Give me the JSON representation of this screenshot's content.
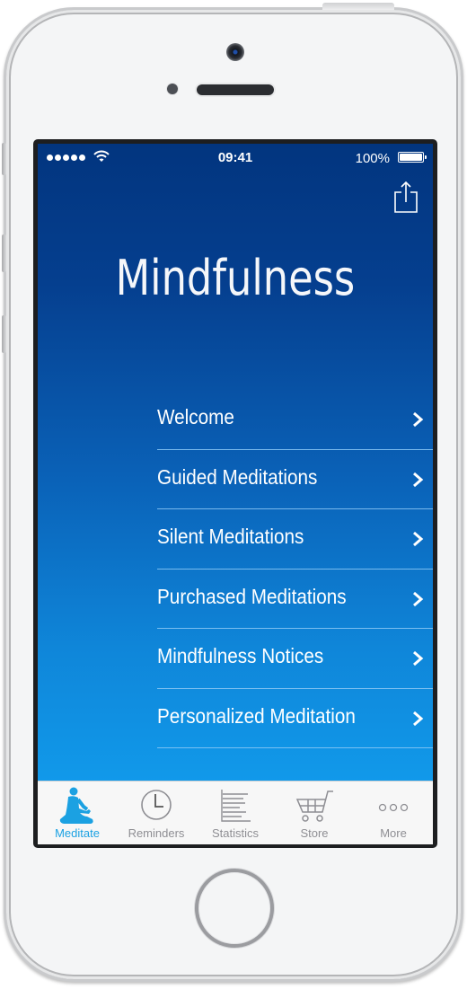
{
  "status_bar": {
    "signal_bars": 5,
    "time": "09:41",
    "battery_percent": "100%",
    "battery_level": 1.0
  },
  "header": {
    "share_icon": "share-icon",
    "title": "Mindfulness"
  },
  "menu": {
    "items": [
      {
        "label": "Welcome",
        "icon": "chevron-right-icon"
      },
      {
        "label": "Guided Meditations",
        "icon": "chevron-right-icon"
      },
      {
        "label": "Silent Meditations",
        "icon": "chevron-right-icon"
      },
      {
        "label": "Purchased Meditations",
        "icon": "chevron-right-icon"
      },
      {
        "label": "Mindfulness Notices",
        "icon": "chevron-right-icon"
      },
      {
        "label": "Personalized Meditation",
        "icon": "chevron-right-icon"
      }
    ]
  },
  "tab_bar": {
    "active_index": 0,
    "tabs": [
      {
        "label": "Meditate",
        "icon": "meditate-icon"
      },
      {
        "label": "Reminders",
        "icon": "clock-icon"
      },
      {
        "label": "Statistics",
        "icon": "statistics-icon"
      },
      {
        "label": "Store",
        "icon": "cart-icon"
      },
      {
        "label": "More",
        "icon": "more-icon"
      }
    ]
  },
  "colors": {
    "gradient_top": "#02357f",
    "gradient_bottom": "#12a2f2",
    "tab_active": "#1ba1e2",
    "tab_inactive": "#8e8e93"
  }
}
